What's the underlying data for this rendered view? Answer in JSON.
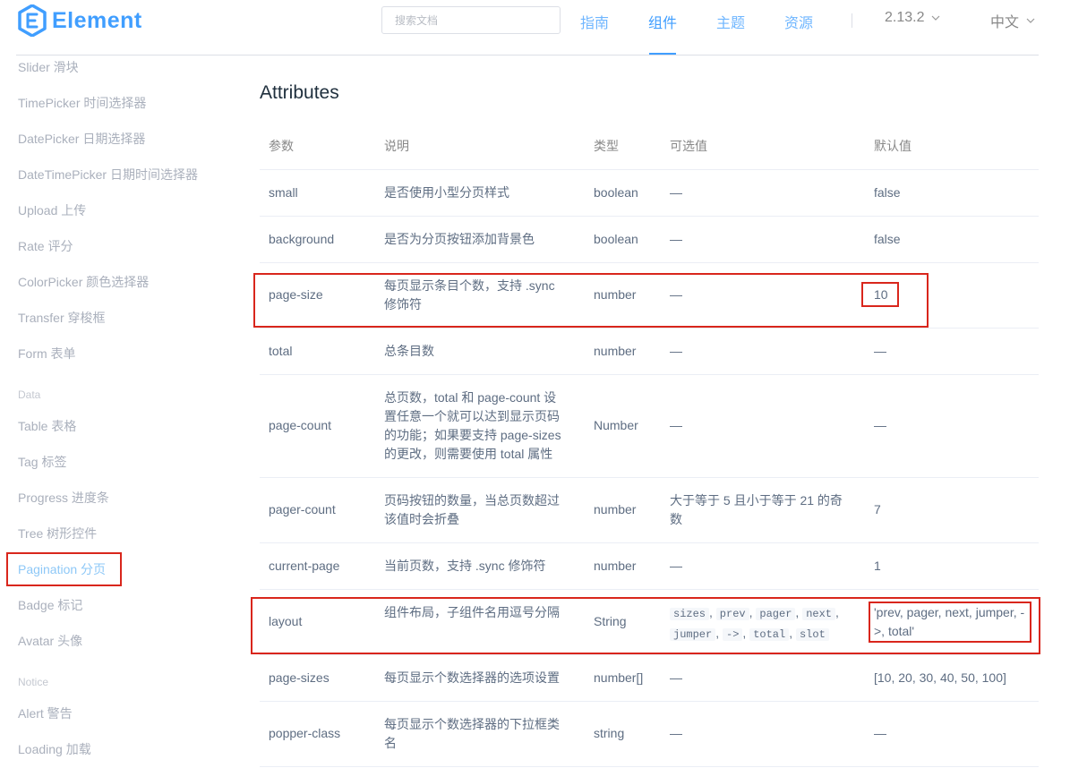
{
  "header": {
    "logo_text": "Element",
    "search_placeholder": "搜索文档",
    "nav": [
      "指南",
      "组件",
      "主题",
      "资源"
    ],
    "version": "2.13.2",
    "language": "中文",
    "colors": {
      "accent": "#409eff"
    }
  },
  "sidebar": {
    "items_top": [
      "Slider 滑块",
      "TimePicker 时间选择器",
      "DatePicker 日期选择器",
      "DateTimePicker 日期时间选择器",
      "Upload 上传",
      "Rate 评分",
      "ColorPicker 颜色选择器",
      "Transfer 穿梭框",
      "Form 表单"
    ],
    "group_data": "Data",
    "items_data": [
      "Table 表格",
      "Tag 标签",
      "Progress 进度条",
      "Tree 树形控件",
      "Pagination 分页",
      "Badge 标记",
      "Avatar 头像"
    ],
    "group_notice": "Notice",
    "items_notice": [
      "Alert 警告",
      "Loading 加载"
    ]
  },
  "main": {
    "title": "Attributes",
    "columns": [
      "参数",
      "说明",
      "类型",
      "可选值",
      "默认值"
    ],
    "rows": [
      {
        "param": "small",
        "desc": "是否使用小型分页样式",
        "type": "boolean",
        "options": "—",
        "default": "false"
      },
      {
        "param": "background",
        "desc": "是否为分页按钮添加背景色",
        "type": "boolean",
        "options": "—",
        "default": "false"
      },
      {
        "param": "page-size",
        "desc_lines": [
          "每页显示条目个数，支持 .sync",
          "修饰符"
        ],
        "type": "number",
        "options": "—",
        "default": "10"
      },
      {
        "param": "total",
        "desc": "总条目数",
        "type": "number",
        "options": "—",
        "default": "—"
      },
      {
        "param": "page-count",
        "desc_lines": [
          "总页数，total 和 page-count 设",
          "置任意一个就可以达到显示页码",
          "的功能；如果要支持 page-sizes",
          "的更改，则需要使用 total 属性"
        ],
        "type": "Number",
        "options": "—",
        "default": "—"
      },
      {
        "param": "pager-count",
        "desc_lines": [
          "页码按钮的数量，当总页数超过",
          "该值时会折叠"
        ],
        "type": "number",
        "options_lines": [
          "大于等于 5 且小于等于 21 的奇",
          "数"
        ],
        "default": "7"
      },
      {
        "param": "current-page",
        "desc": "当前页数，支持 .sync 修饰符",
        "type": "number",
        "options": "—",
        "default": "1"
      },
      {
        "param": "layout",
        "desc": "组件布局，子组件名用逗号分隔",
        "type": "String",
        "options_codes": [
          "sizes",
          "prev",
          "pager",
          "next",
          "jumper",
          "->",
          "total",
          "slot"
        ],
        "default_lines": [
          "'prev, pager, next, jumper, -",
          ">, total'"
        ]
      },
      {
        "param": "page-sizes",
        "desc": "每页显示个数选择器的选项设置",
        "type": "number[]",
        "options": "—",
        "default": "[10, 20, 30, 40, 50, 100]"
      },
      {
        "param": "popper-class",
        "desc_lines": [
          "每页显示个数选择器的下拉框类",
          "名"
        ],
        "type": "string",
        "options": "—",
        "default": "—"
      }
    ]
  }
}
